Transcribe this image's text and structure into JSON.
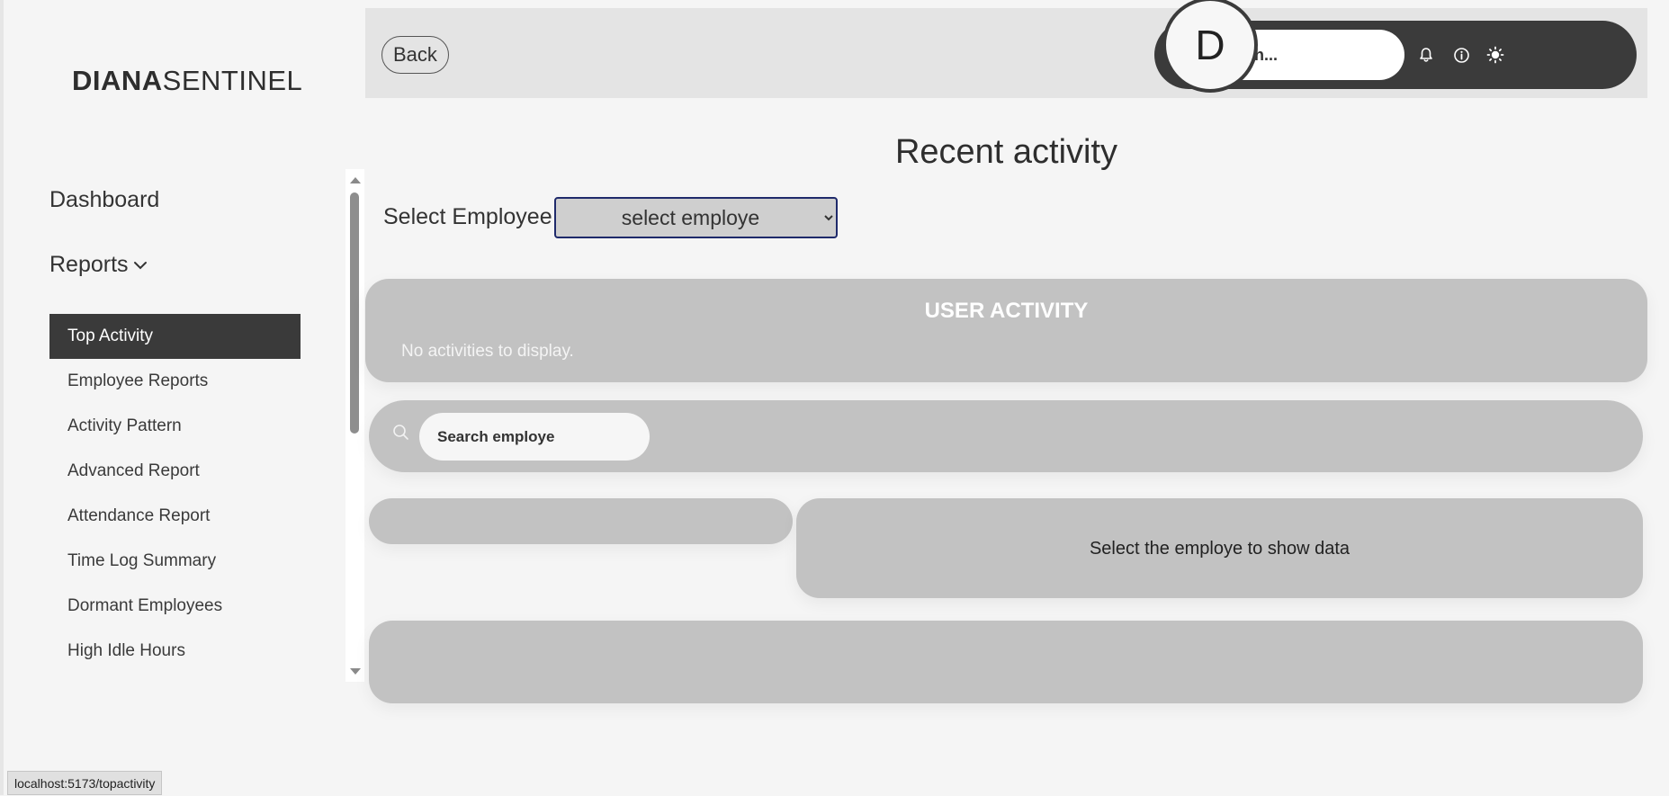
{
  "brand": {
    "strong": "DIANA",
    "light": "SENTINEL"
  },
  "sidebar": {
    "dashboard": "Dashboard",
    "reports": "Reports",
    "items": [
      {
        "label": "Top Activity",
        "active": true
      },
      {
        "label": "Employee Reports",
        "active": false
      },
      {
        "label": "Activity Pattern",
        "active": false
      },
      {
        "label": "Advanced Report",
        "active": false
      },
      {
        "label": "Attendance Report",
        "active": false
      },
      {
        "label": "Time Log Summary",
        "active": false
      },
      {
        "label": "Dormant Employees",
        "active": false
      },
      {
        "label": "High Idle Hours",
        "active": false
      }
    ]
  },
  "header": {
    "back_label": "Back",
    "search_placeholder": "Search...",
    "avatar_initial": "D",
    "icons": [
      "bell-icon",
      "info-icon",
      "sun-icon"
    ]
  },
  "main": {
    "title": "Recent activity",
    "select_label": "Select Employee",
    "select_value": "select employe",
    "activity_title": "USER ACTIVITY",
    "activity_empty": "No activities to display.",
    "employee_search_placeholder": "Search employe",
    "data_message": "Select the employe to show data"
  },
  "statusbar": {
    "url": "localhost:5173/topactivity"
  },
  "colors": {
    "background": "#f5f5f5",
    "active_nav": "#3a3a3a",
    "panel": "#c2c2c2",
    "toolbar": "#3b3b3b",
    "select_border": "#1f2a6b"
  }
}
